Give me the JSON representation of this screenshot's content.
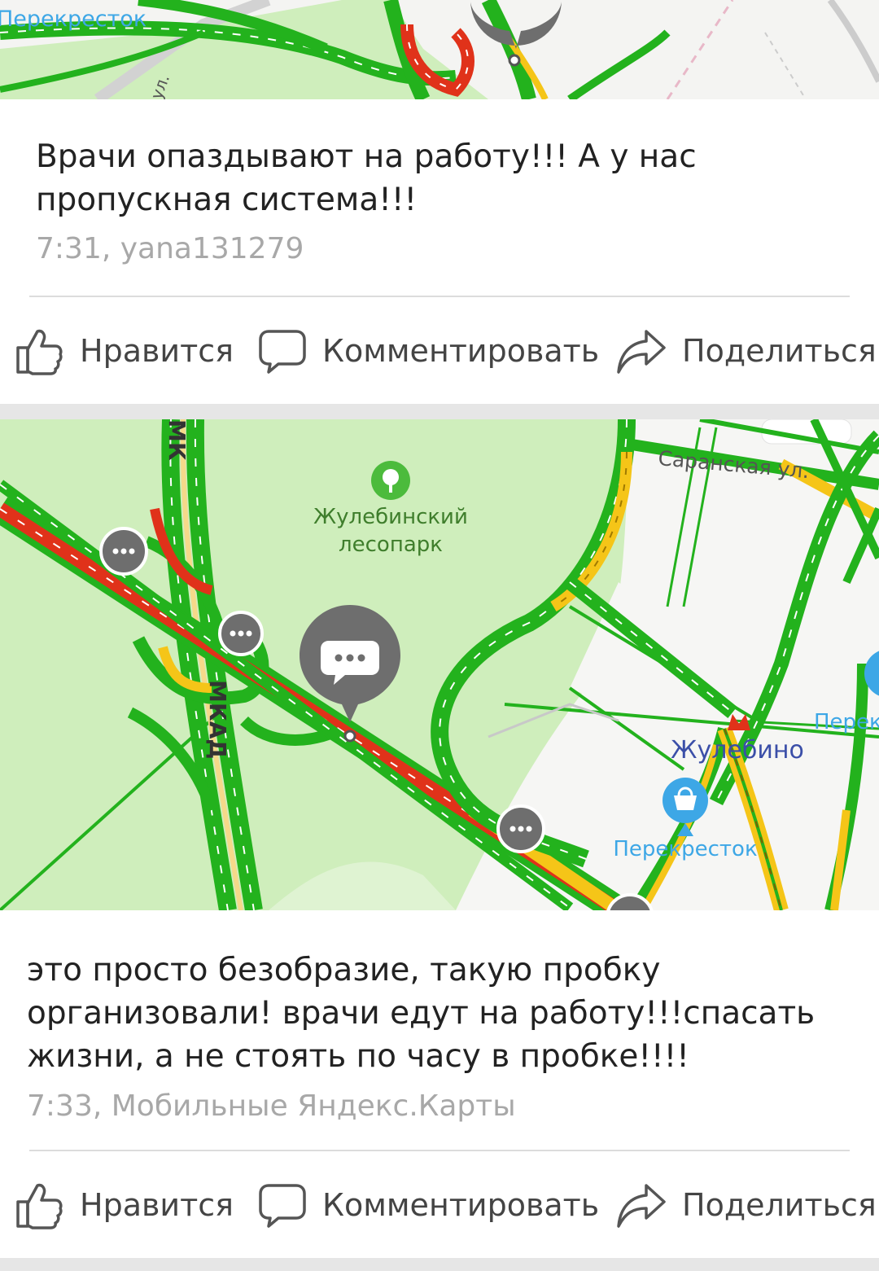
{
  "posts": [
    {
      "map": {
        "labels": {
          "store": "Перекресток",
          "street": "ул."
        }
      },
      "text_lines": [
        "Врачи опаздывают на работу!!! А у нас",
        "пропускная система!!!"
      ],
      "meta": "7:31, yana131279",
      "actions": {
        "like": "Нравится",
        "comment": "Комментировать",
        "share": "Поделиться"
      }
    },
    {
      "map": {
        "labels": {
          "park_line1": "Жулебинский",
          "park_line2": "лесопарк",
          "street": "Саранская ул.",
          "mkad_vertical": "МКАД",
          "mkad_top": "МК",
          "metro": "Жулебино",
          "store": "Перекресток",
          "store_edge": "Перек"
        }
      },
      "text_lines": [
        "это просто безобразие, такую пробку",
        "организовали! врачи едут на работу!!!спасать",
        "жизни, а не стоять по часу в пробке!!!!"
      ],
      "meta": "7:33, Мобильные Яндекс.Карты",
      "actions": {
        "like": "Нравится",
        "comment": "Комментировать",
        "share": "Поделиться"
      }
    }
  ],
  "colors": {
    "traffic_free": "#23b21d",
    "traffic_slow": "#f5c518",
    "traffic_jam": "#e0321a",
    "park": "#cfeebc",
    "metro": "#e0321a",
    "store_pin": "#3da7e6",
    "comment_pin": "#6e6e6e"
  }
}
